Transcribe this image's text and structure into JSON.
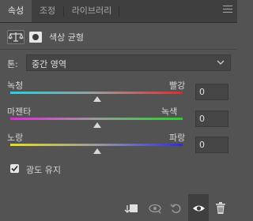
{
  "tabs": [
    {
      "label": "속성",
      "active": true
    },
    {
      "label": "조정",
      "active": false
    },
    {
      "label": "라이브러리",
      "active": false
    }
  ],
  "header": {
    "title": "색상 균형",
    "icons": [
      "balance-scale-icon",
      "layer-mask-icon"
    ]
  },
  "tone": {
    "label": "톤:",
    "value": "중간 영역"
  },
  "sliders": [
    {
      "left_label": "녹청",
      "right_label": "빨강",
      "value": "0",
      "level": 0.5,
      "colors": [
        "#22d3e4",
        "#e22b2b"
      ]
    },
    {
      "left_label": "마젠타",
      "right_label": "녹색",
      "value": "0",
      "level": 0.5,
      "colors": [
        "#e02ad8",
        "#23d429"
      ]
    },
    {
      "left_label": "노랑",
      "right_label": "파랑",
      "value": "0",
      "level": 0.5,
      "colors": [
        "#e6df22",
        "#2a2ee0"
      ]
    }
  ],
  "preserve_luminosity": {
    "label": "광도 유지",
    "checked": true
  },
  "bottom_icons": [
    "clip-to-layer-icon",
    "view-previous-state-icon",
    "reset-icon",
    "visibility-eye-icon",
    "delete-trash-icon"
  ],
  "colors": {
    "panel_bg": "#535353",
    "tab_bar_bg": "#3f3f3f",
    "input_bg": "#454545",
    "text": "#d6d6d6"
  }
}
